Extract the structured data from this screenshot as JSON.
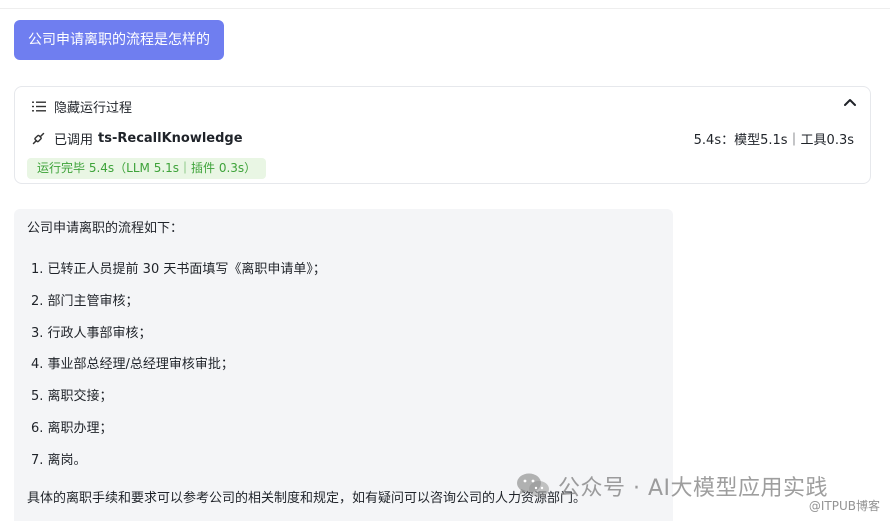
{
  "query": {
    "text": "公司申请离职的流程是怎样的"
  },
  "process": {
    "toggle_label": "隐藏运行过程",
    "tool_called_label": "已调用",
    "tool_name": "ts-RecallKnowledge",
    "tool_timing": "5.4s：模型5.1s｜工具0.3s",
    "status": "运行完毕 5.4s（LLM 5.1s｜插件 0.3s）"
  },
  "answer": {
    "intro": "公司申请离职的流程如下：",
    "steps": [
      "1. 已转正人员提前 30 天书面填写《离职申请单》；",
      "2. 部门主管审核；",
      "3. 行政人事部审核；",
      "4. 事业部总经理/总经理审核审批；",
      "5. 离职交接；",
      "6. 离职办理；",
      "7. 离岗。"
    ],
    "footer": "具体的离职手续和要求可以参考公司的相关制度和规定，如有疑问可以咨询公司的人力资源部门。"
  },
  "watermark": {
    "text": "公众号 · AI大模型应用实践",
    "sub": "@ITPUB博客",
    "icon": "wechat-icon"
  },
  "colors": {
    "query_bg": "#6f7ef0",
    "status_bg": "#e9f6e4",
    "status_text": "#3ea33a",
    "answer_bg": "#f4f5f7"
  },
  "icons": {
    "toggle": "list-icon",
    "collapse": "chevron-up-icon",
    "tool": "plugin-icon"
  }
}
